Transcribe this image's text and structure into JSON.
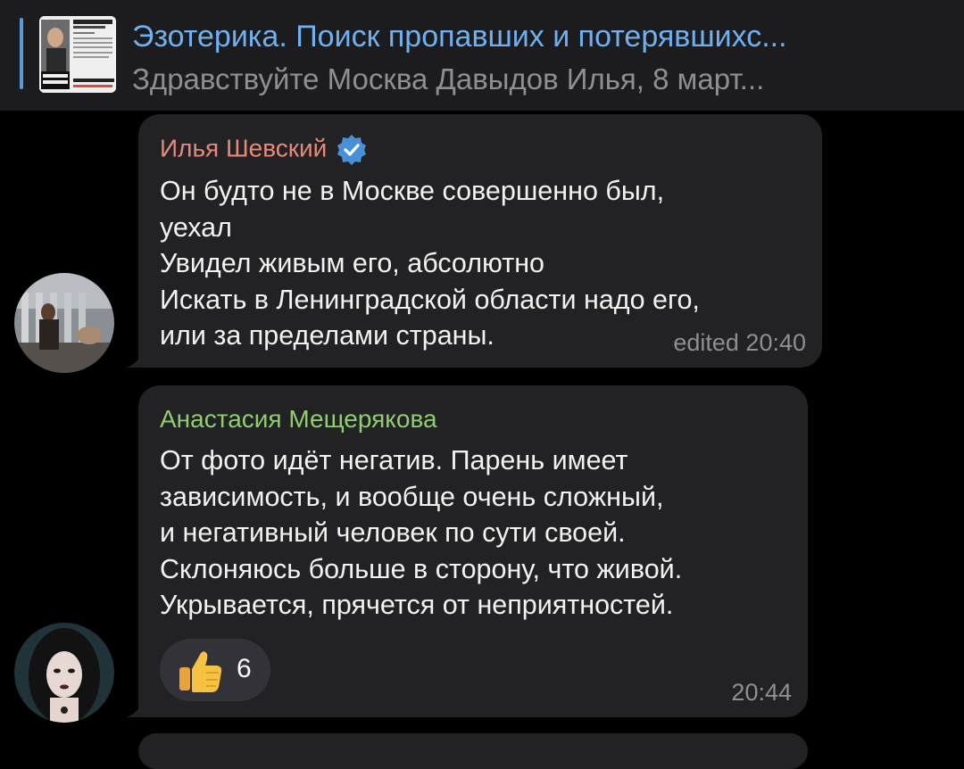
{
  "pinned": {
    "title": "Эзотерика. Поиск пропавших и потерявшихс...",
    "subtitle": "Здравствуйте Москва Давыдов Илья, 8 март..."
  },
  "messages": [
    {
      "sender": "Илья Шевский",
      "verified": true,
      "lines": [
        "Он будто не в Москве совершенно был,",
        "уехал",
        "Увидел живым его, абсолютно",
        "Искать в Ленинградской области надо его,",
        "или за пределами страны."
      ],
      "meta": "edited 20:40"
    },
    {
      "sender": "Анастасия Мещерякова",
      "lines": [
        "От фото идёт негатив. Парень имеет",
        "зависимость, и вообще очень сложный,",
        "и негативный человек по сути своей.",
        "Склоняюсь больше в сторону, что живой.",
        "Укрывается, прячется от неприятностей."
      ],
      "reaction": {
        "emoji": "thumbs-up-icon",
        "count": "6"
      },
      "meta": "20:44"
    }
  ],
  "colors": {
    "accent": "#6fb0f0",
    "sender1": "#e38a7a",
    "sender2": "#8fce6f",
    "bubble": "#222224",
    "background": "#000000"
  }
}
